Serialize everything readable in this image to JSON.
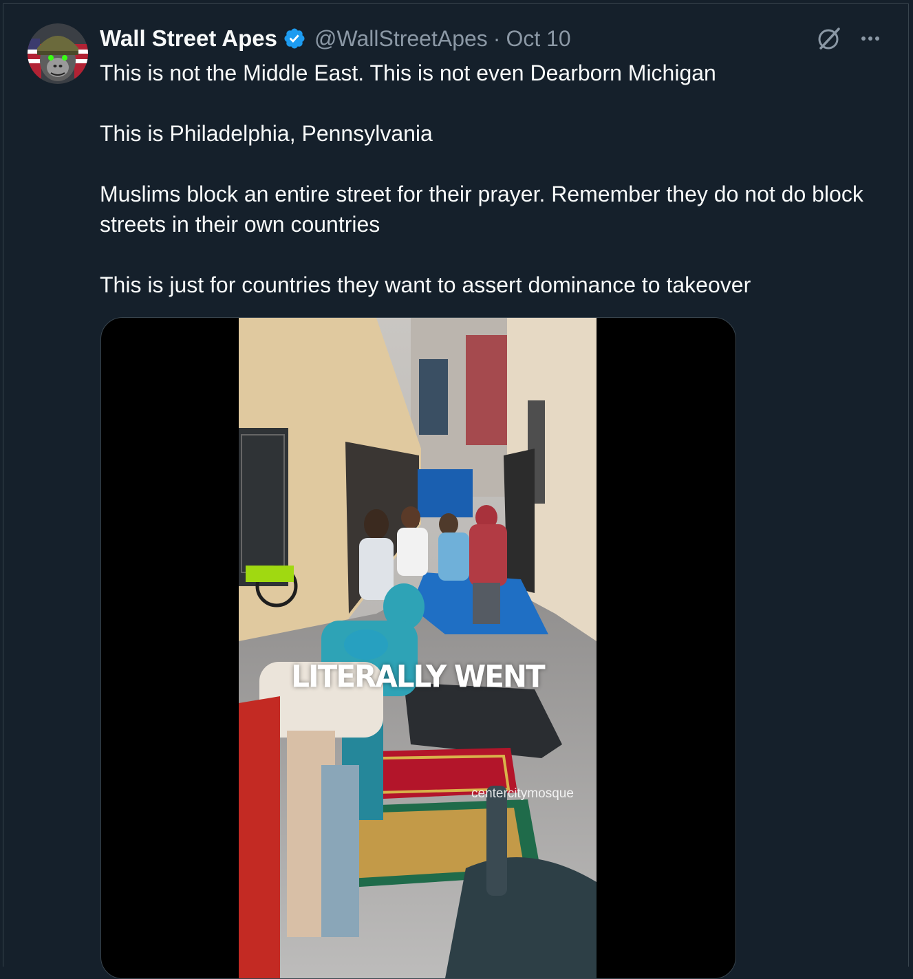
{
  "tweet": {
    "author": {
      "display_name": "Wall Street Apes",
      "handle": "@WallStreetApes",
      "verified": true,
      "avatar_icon": "gorilla-soldier-avatar"
    },
    "separator": "·",
    "date": "Oct 10",
    "actions": {
      "grok_icon": "grok-icon",
      "more_icon": "more-options-icon"
    },
    "paragraphs": [
      "This is not the Middle East. This is not even Dearborn Michigan",
      "This is Philadelphia, Pennsylvania",
      "Muslims block an entire street for their prayer. Remember they do not do block streets in their own countries",
      "This is just for countries they want to assert dominance to takeover"
    ],
    "media": {
      "type": "video",
      "caption_overlay": "LITERALLY WENT",
      "watermark": "centercitymosque"
    }
  },
  "colors": {
    "background": "#15202b",
    "text_primary": "#f7f9f9",
    "text_secondary": "#8b98a5",
    "verified_blue": "#1d9bf0",
    "border": "#38444d"
  }
}
